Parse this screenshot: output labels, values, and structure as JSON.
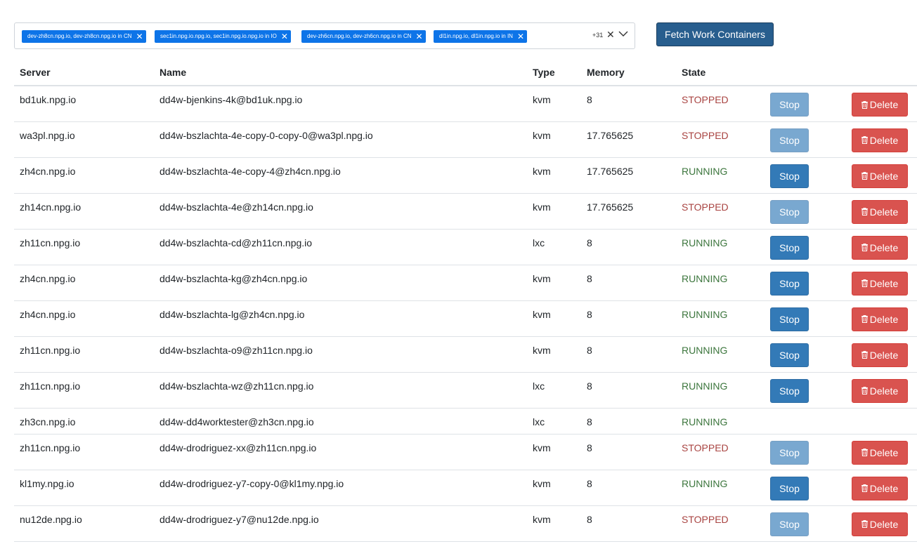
{
  "selector": {
    "chips": [
      "dev-zh8cn.npg.io, dev-zh8cn.npg.io in CN",
      "sec1in.npg.io.npg.io, sec1in.npg.io.npg.io in IO",
      "dev-zh6cn.npg.io, dev-zh6cn.npg.io in CN",
      "dl1in.npg.io, dl1in.npg.io in IN"
    ],
    "more_count": "+31",
    "chip_remove_glyph": "✕",
    "clear_glyph": "✕"
  },
  "fetch_button": "Fetch Work Containers",
  "table": {
    "headers": [
      "Server",
      "Name",
      "Type",
      "Memory",
      "State"
    ],
    "stop_label": "Stop",
    "delete_label": "Delete",
    "rows": [
      {
        "server": "bd1uk.npg.io",
        "name": "dd4w-bjenkins-4k@bd1uk.npg.io",
        "type": "kvm",
        "memory": "8",
        "state": "STOPPED"
      },
      {
        "server": "wa3pl.npg.io",
        "name": "dd4w-bszlachta-4e-copy-0-copy-0@wa3pl.npg.io",
        "type": "kvm",
        "memory": "17.765625",
        "state": "STOPPED"
      },
      {
        "server": "zh4cn.npg.io",
        "name": "dd4w-bszlachta-4e-copy-4@zh4cn.npg.io",
        "type": "kvm",
        "memory": "17.765625",
        "state": "RUNNING"
      },
      {
        "server": "zh14cn.npg.io",
        "name": "dd4w-bszlachta-4e@zh14cn.npg.io",
        "type": "kvm",
        "memory": "17.765625",
        "state": "STOPPED"
      },
      {
        "server": "zh11cn.npg.io",
        "name": "dd4w-bszlachta-cd@zh11cn.npg.io",
        "type": "lxc",
        "memory": "8",
        "state": "RUNNING"
      },
      {
        "server": "zh4cn.npg.io",
        "name": "dd4w-bszlachta-kg@zh4cn.npg.io",
        "type": "kvm",
        "memory": "8",
        "state": "RUNNING"
      },
      {
        "server": "zh4cn.npg.io",
        "name": "dd4w-bszlachta-lg@zh4cn.npg.io",
        "type": "kvm",
        "memory": "8",
        "state": "RUNNING"
      },
      {
        "server": "zh11cn.npg.io",
        "name": "dd4w-bszlachta-o9@zh11cn.npg.io",
        "type": "kvm",
        "memory": "8",
        "state": "RUNNING"
      },
      {
        "server": "zh11cn.npg.io",
        "name": "dd4w-bszlachta-wz@zh11cn.npg.io",
        "type": "lxc",
        "memory": "8",
        "state": "RUNNING"
      },
      {
        "server": "zh3cn.npg.io",
        "name": "dd4w-dd4worktester@zh3cn.npg.io",
        "type": "lxc",
        "memory": "8",
        "state": "RUNNING",
        "no_actions": true
      },
      {
        "server": "zh11cn.npg.io",
        "name": "dd4w-drodriguez-xx@zh11cn.npg.io",
        "type": "kvm",
        "memory": "8",
        "state": "STOPPED"
      },
      {
        "server": "kl1my.npg.io",
        "name": "dd4w-drodriguez-y7-copy-0@kl1my.npg.io",
        "type": "kvm",
        "memory": "8",
        "state": "RUNNING"
      },
      {
        "server": "nu12de.npg.io",
        "name": "dd4w-drodriguez-y7@nu12de.npg.io",
        "type": "kvm",
        "memory": "8",
        "state": "STOPPED"
      }
    ]
  },
  "colors": {
    "chip_bg": "#0d74e8",
    "fetch_bg": "#285e8e",
    "stop_bg": "#337ab7",
    "delete_bg": "#d9534f",
    "stopped_text": "#a94442",
    "running_text": "#3c763d"
  },
  "icons": {
    "chip_remove": "close-icon",
    "clear": "close-icon",
    "dropdown": "chevron-down-icon",
    "delete": "trash-icon"
  }
}
